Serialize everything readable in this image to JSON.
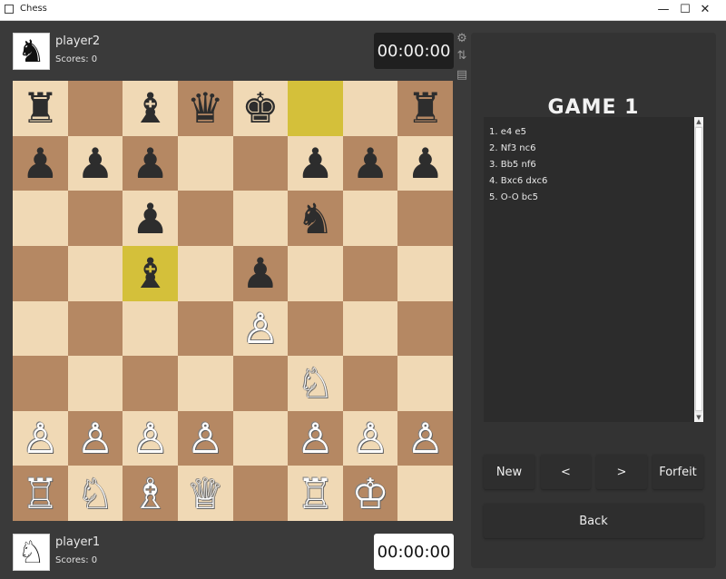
{
  "window": {
    "title": "Chess",
    "min_label": "—",
    "max_label": "☐",
    "close_label": "✕"
  },
  "top_player": {
    "name": "player2",
    "score": "Scores: 0",
    "avatar": "♞",
    "clock": "00:00:00"
  },
  "bottom_player": {
    "name": "player1",
    "score": "Scores: 0",
    "avatar": "♘",
    "clock": "00:00:00"
  },
  "tools": {
    "settings": "⚙",
    "flip": "⇅",
    "save": "▤"
  },
  "game_title": "GAME 1",
  "moves": [
    "1. e4 e5",
    "2. Nf3 nc6",
    "3. Bb5 nf6",
    "4. Bxc6 dxc6",
    "5. O-O bc5"
  ],
  "buttons": {
    "new": "New",
    "prev": "<",
    "next": ">",
    "forfeit": "Forfeit",
    "back": "Back"
  },
  "board": [
    [
      "♜",
      "",
      "♝",
      "♛",
      "♚",
      "",
      "",
      "♜"
    ],
    [
      "♟",
      "♟",
      "♟",
      "",
      "",
      "♟",
      "♟",
      "♟"
    ],
    [
      "",
      "",
      "♟",
      "",
      "",
      "♞",
      "",
      ""
    ],
    [
      "",
      "",
      "♝",
      "",
      "♟",
      "",
      "",
      ""
    ],
    [
      "",
      "",
      "",
      "",
      "♙",
      "",
      "",
      ""
    ],
    [
      "",
      "",
      "",
      "",
      "",
      "♘",
      "",
      ""
    ],
    [
      "♙",
      "♙",
      "♙",
      "♙",
      "",
      "♙",
      "♙",
      "♙"
    ],
    [
      "♖",
      "♘",
      "♗",
      "♕",
      "",
      "♖",
      "♔",
      ""
    ]
  ],
  "highlighted_squares": [
    "f8",
    "c5"
  ],
  "colors": {
    "light_square": "#f0d9b5",
    "dark_square": "#b58863",
    "highlight": "#d4c03a"
  }
}
